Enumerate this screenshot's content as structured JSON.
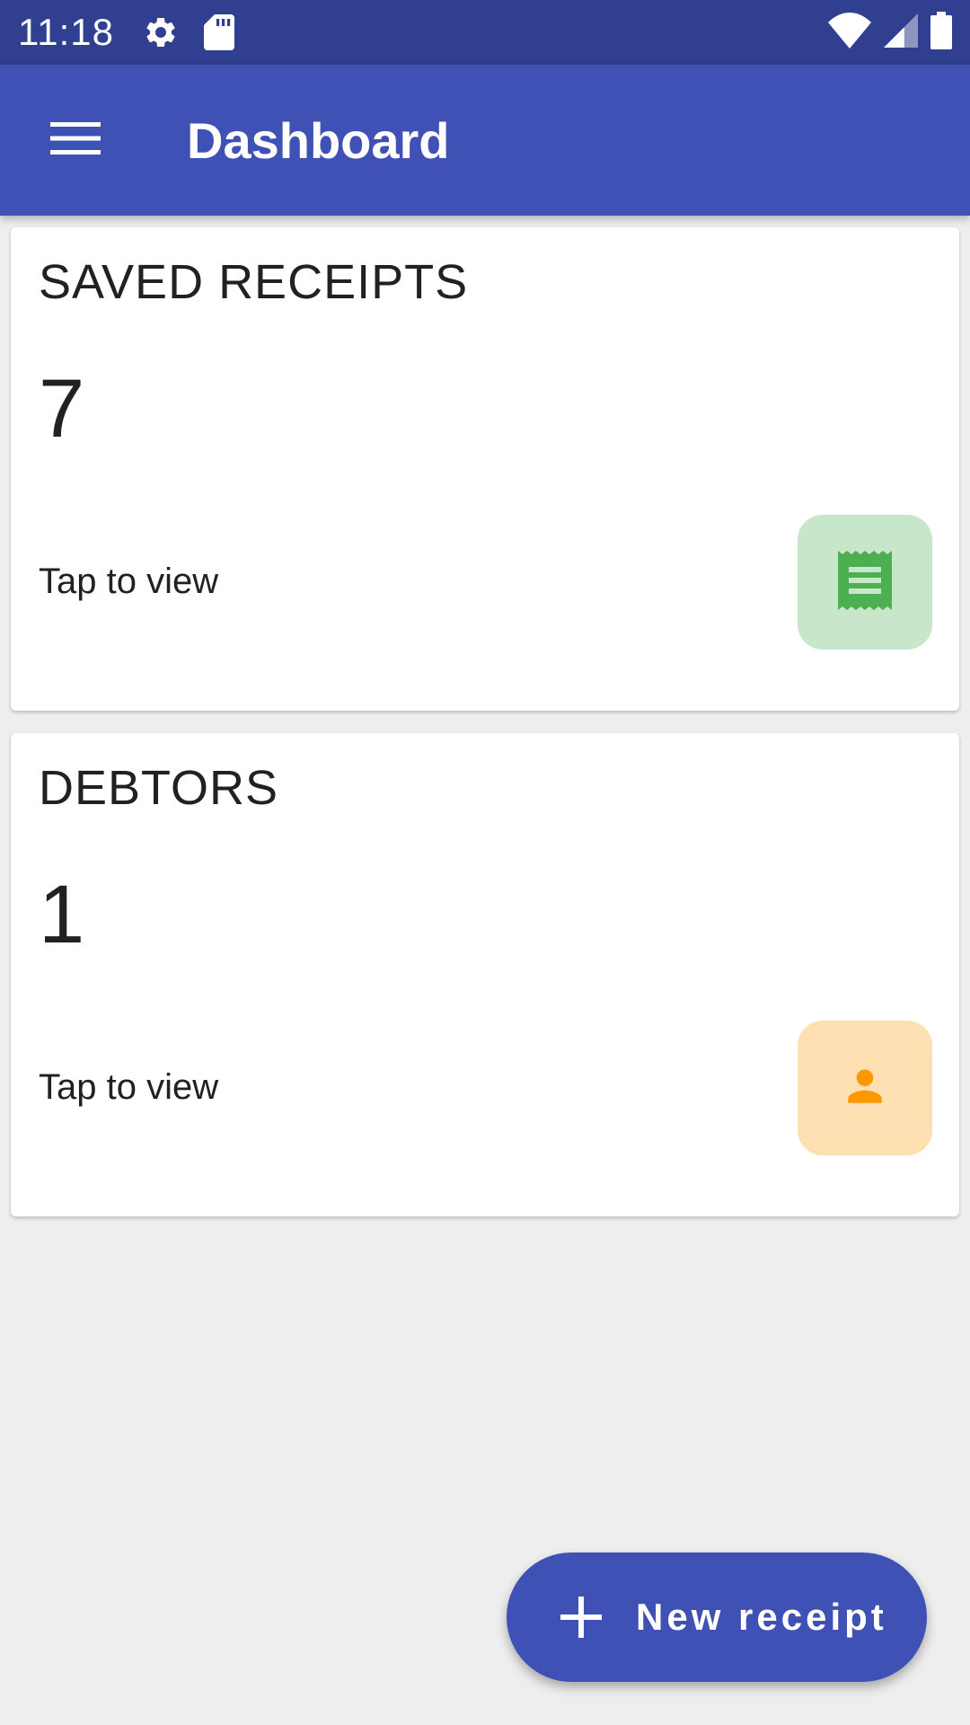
{
  "status_bar": {
    "time": "11:18",
    "left_icons": [
      "gear-icon",
      "sd-card-icon"
    ],
    "right_icons": [
      "wifi-icon",
      "cell-signal-icon",
      "battery-icon"
    ]
  },
  "app_bar": {
    "title": "Dashboard",
    "menu_icon": "hamburger-menu-icon",
    "color": "#3f51b5"
  },
  "cards": [
    {
      "title": "SAVED RECEIPTS",
      "count": "7",
      "hint": "Tap to view",
      "icon": "receipt-icon",
      "icon_color": "#4caf50",
      "icon_bg": "#c8e6c9"
    },
    {
      "title": "DEBTORS",
      "count": "1",
      "hint": "Tap to view",
      "icon": "person-icon",
      "icon_color": "#ff9800",
      "icon_bg": "#ffe0b2"
    }
  ],
  "fab": {
    "label": "New receipt",
    "icon": "plus-icon"
  }
}
